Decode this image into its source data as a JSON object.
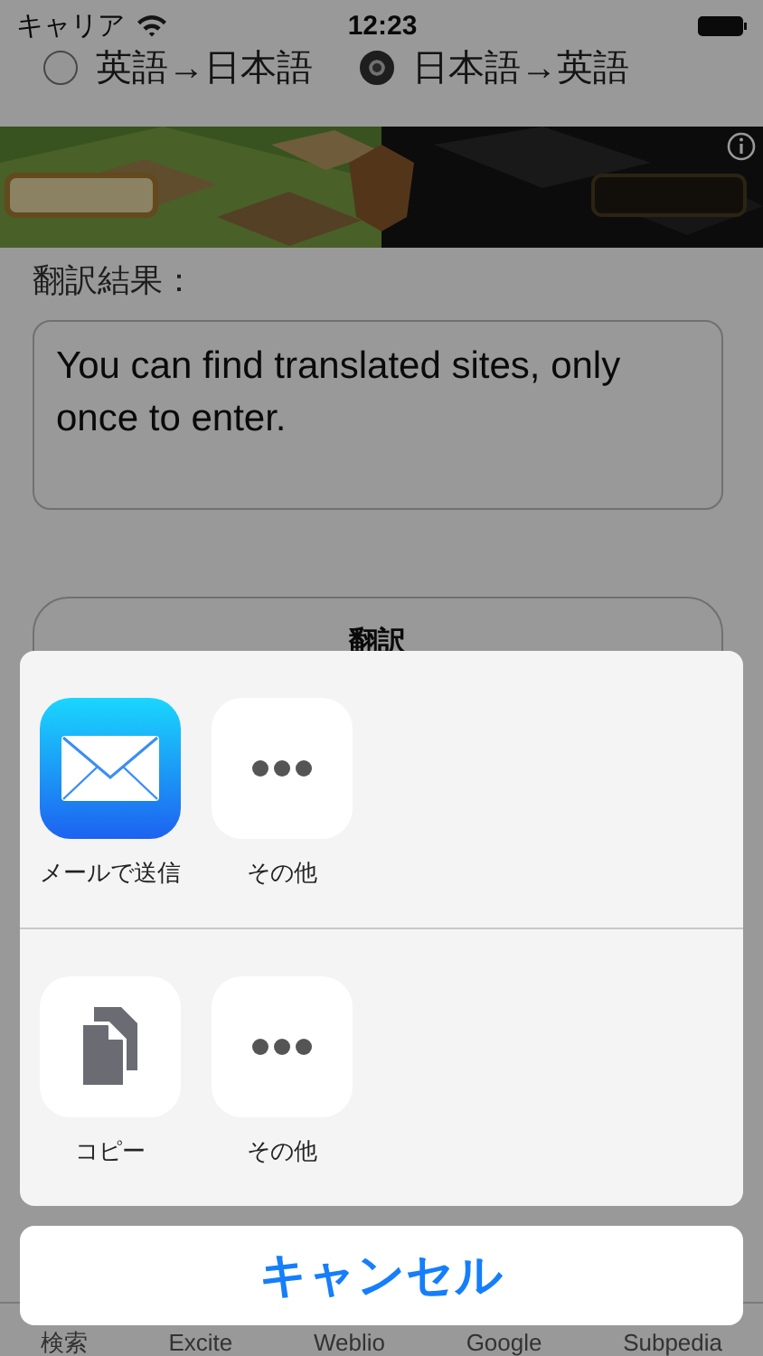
{
  "status_bar": {
    "carrier": "キャリア",
    "time": "12:23"
  },
  "direction_options": [
    {
      "label": "英語→日本語",
      "selected": false
    },
    {
      "label": "日本語→英語",
      "selected": true
    }
  ],
  "result_label": "翻訳結果：",
  "result_text": "You can find translated sites, only once to enter.",
  "translate_button": "翻訳",
  "tab_bar": {
    "items": [
      "検索",
      "Excite",
      "Weblio",
      "Google",
      "Subpedia"
    ]
  },
  "share_sheet": {
    "rows": [
      [
        {
          "kind": "mail",
          "label": "メールで送信"
        },
        {
          "kind": "more",
          "label": "その他"
        }
      ],
      [
        {
          "kind": "copy",
          "label": "コピー"
        },
        {
          "kind": "more",
          "label": "その他"
        }
      ]
    ],
    "cancel": "キャンセル"
  }
}
